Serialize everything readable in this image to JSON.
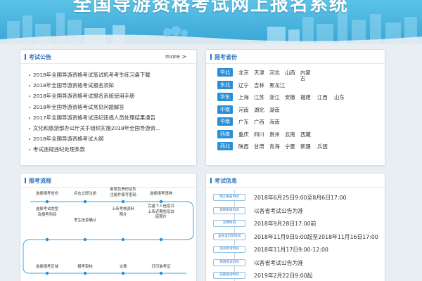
{
  "banner": {
    "title": "全国导游资格考试网上报名系统"
  },
  "notice": {
    "title": "考试公告",
    "more": "more >",
    "items": [
      "2018年全国导游资格考试笔试机考考生练习盘下载",
      "2018年全国导游资格考试报名须知",
      "2018年全国导游资格考试报名系统使用手册",
      "2018年全国导游资格考试常见问题解答",
      "2017年全国导游资格考试违纪违规人员处理结果通告",
      "文化和旅游部办公厅关于组织实施2018年全国导游资...",
      "2018年全国导游资格考试大纲",
      "考试违规违纪处理条款"
    ]
  },
  "regions": {
    "title": "报考省份",
    "rows": [
      {
        "tag": "华北",
        "provinces": [
          "北京",
          "天津",
          "河北",
          "山西",
          "内蒙",
          "古"
        ]
      },
      {
        "tag": "东北",
        "provinces": [
          "辽宁",
          "吉林",
          "黑龙江"
        ]
      },
      {
        "tag": "华东",
        "provinces": [
          "上海",
          "江苏",
          "浙江",
          "安徽",
          "福建",
          "江西",
          "山东"
        ]
      },
      {
        "tag": "中南",
        "provinces": [
          "河南",
          "湖北",
          "湖南"
        ]
      },
      {
        "tag": "华南",
        "provinces": [
          "广东",
          "广西",
          "海南"
        ]
      },
      {
        "tag": "西南",
        "provinces": [
          "重庆",
          "四川",
          "贵州",
          "云南",
          "西藏"
        ]
      },
      {
        "tag": "西北",
        "provinces": [
          "陕西",
          "甘肃",
          "青海",
          "宁夏",
          "新疆",
          "兵团"
        ]
      }
    ]
  },
  "flow": {
    "title": "报考流程",
    "steps": [
      "选择报考省份",
      "点击立即注册",
      "用常负责份证件\n注册并填写密码",
      "选择报考语种",
      "选择考试类型\n及报考科目",
      "考生信息确认",
      "上传考核资料\n照片",
      "完善个人信息并\n上传近期免冠白\n底照片",
      "选择报考区域",
      "报考审核",
      "交费",
      "打印准考证"
    ]
  },
  "info": {
    "title": "考试信息",
    "rows": [
      {
        "tag": "网上报名时间",
        "value": "2018年6月25日9:00至8月6日17:00"
      },
      {
        "tag": "资格审核时间",
        "value": "以各省考试公告为准"
      },
      {
        "tag": "交费时间",
        "value": "2018年9月28日17:00前"
      },
      {
        "tag": "准考证打印时间",
        "value": "2018年11月9日9:00起至2018年11月16日17:00"
      },
      {
        "tag": "笔试考试时间",
        "value": "2018年11月17日9:00-12:00"
      },
      {
        "tag": "现场考试时间",
        "value": "以各省考试公告为准"
      },
      {
        "tag": "成绩查询时间",
        "value": "2019年2月22日9:00起"
      }
    ]
  },
  "colors": {
    "banner": "#3aa6d6",
    "accent": "#2b76c4",
    "tag": "#2b8fd6"
  }
}
